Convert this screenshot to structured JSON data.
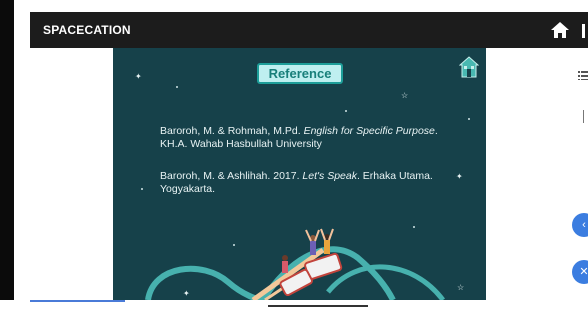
{
  "app": {
    "title": "SPACECATION"
  },
  "slide": {
    "heading": "Reference",
    "references": [
      {
        "authors": "Baroroh, M. & Rohmah, M.Pd. ",
        "title": "English for Specific Purpose",
        "rest": ". KH.A. Wahab Hasbullah University"
      },
      {
        "authors": "Baroroh, M. & Ashlihah. 2017. ",
        "title": "Let's Speak",
        "rest": ". Erhaka Utama. Yogyakarta."
      }
    ]
  },
  "icons": {
    "home": "home-icon",
    "slide_home": "house-icon",
    "menu": "menu-icon",
    "previous": "chevron-left-icon",
    "close": "close-icon"
  },
  "colors": {
    "topbar": "#1c1c1c",
    "slide_background": "#16414a",
    "heading_fill": "#bfeff0",
    "heading_border": "#1d9e99",
    "accent_blue": "#3b7de0"
  }
}
